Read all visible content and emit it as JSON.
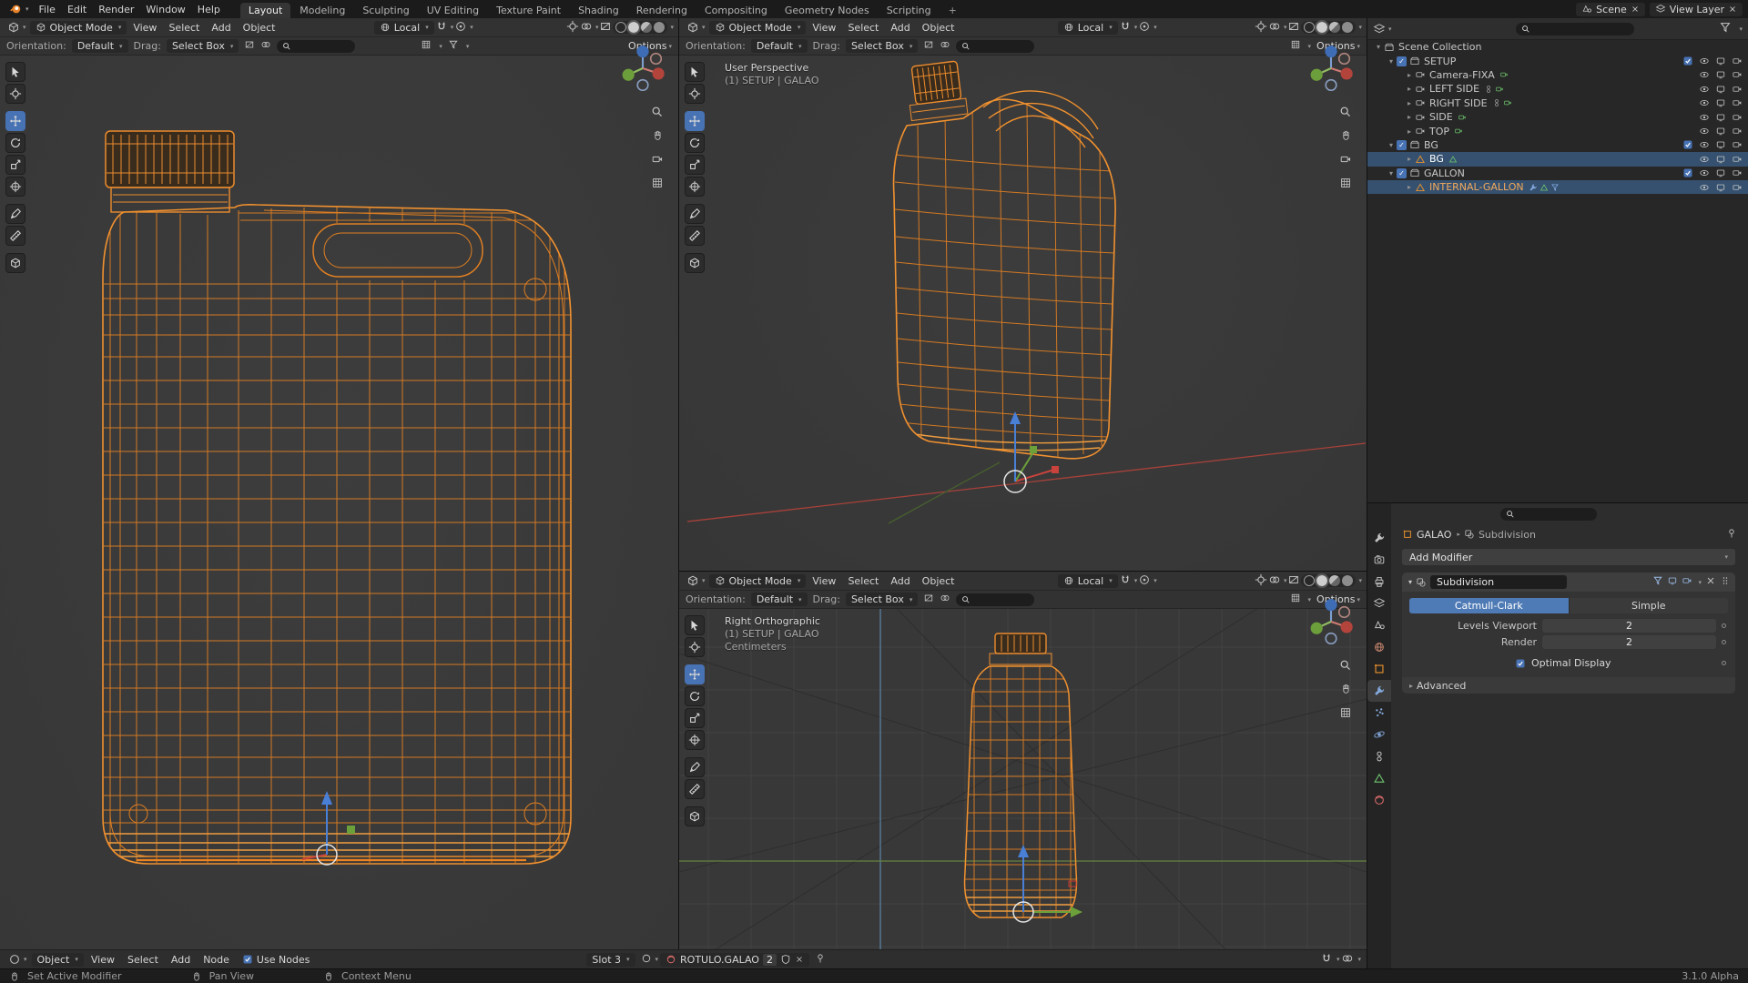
{
  "topbar": {
    "app_menus": [
      "File",
      "Edit",
      "Render",
      "Window",
      "Help"
    ],
    "tabs": [
      "Layout",
      "Modeling",
      "Sculpting",
      "UV Editing",
      "Texture Paint",
      "Shading",
      "Rendering",
      "Compositing",
      "Geometry Nodes",
      "Scripting"
    ],
    "active_tab": "Layout",
    "scene_name": "Scene",
    "view_layer_name": "View Layer"
  },
  "viewport": {
    "mode": "Object Mode",
    "menu_view": "View",
    "menu_select": "Select",
    "menu_add": "Add",
    "menu_object": "Object",
    "orientation": "Local",
    "tool_orientation_label": "Orientation:",
    "tool_orientation_value": "Default",
    "tool_drag_label": "Drag:",
    "tool_drag_value": "Select Box",
    "options_label": "Options"
  },
  "viewport_labels": {
    "persp_line1": "User Perspective",
    "persp_line2": "(1) SETUP | GALAO",
    "ortho_line1": "Right Orthographic",
    "ortho_line2": "(1) SETUP | GALAO",
    "ortho_line3": "Centimeters"
  },
  "outliner": {
    "rows": [
      {
        "label": "Scene Collection"
      },
      {
        "label": "SETUP"
      },
      {
        "label": "Camera-FIXA"
      },
      {
        "label": "LEFT SIDE"
      },
      {
        "label": "RIGHT SIDE"
      },
      {
        "label": "SIDE"
      },
      {
        "label": "TOP"
      },
      {
        "label": "BG"
      },
      {
        "label": "BG"
      },
      {
        "label": "GALLON"
      },
      {
        "label": "INTERNAL-GALLON"
      }
    ]
  },
  "properties": {
    "breadcrumb_object": "GALAO",
    "breadcrumb_item": "Subdivision",
    "add_modifier_label": "Add Modifier",
    "modifier_name": "Subdivision",
    "seg_catmull": "Catmull-Clark",
    "seg_simple": "Simple",
    "levels_viewport_label": "Levels Viewport",
    "levels_viewport_value": "2",
    "render_label": "Render",
    "render_value": "2",
    "optimal_display_label": "Optimal Display",
    "advanced_label": "Advanced"
  },
  "shader_editor": {
    "type_label": "Object",
    "menu_view": "View",
    "menu_select": "Select",
    "menu_add": "Add",
    "menu_node": "Node",
    "use_nodes_label": "Use Nodes",
    "slot_label": "Slot 3",
    "material_name": "ROTULO.GALAO",
    "users_count": "2"
  },
  "statusbar": {
    "hint_primary": "Set Active Modifier",
    "hint_pan": "Pan View",
    "hint_context": "Context Menu",
    "version": "3.1.0 Alpha"
  }
}
